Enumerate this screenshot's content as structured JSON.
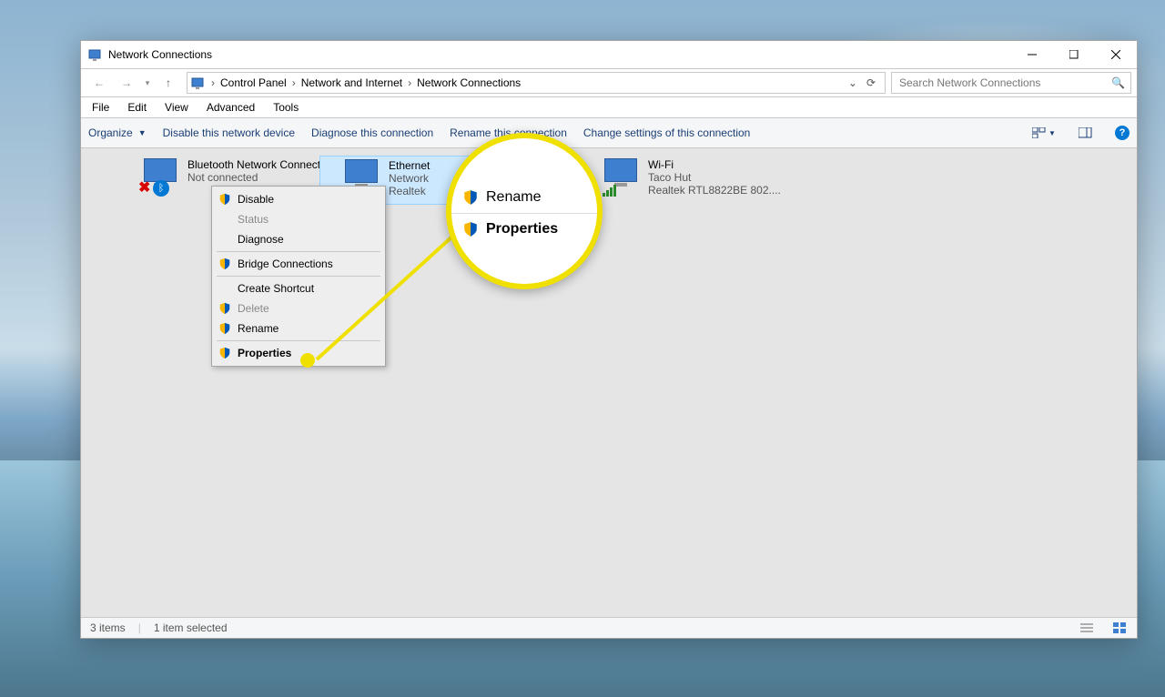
{
  "title": "Network Connections",
  "breadcrumb": [
    "Control Panel",
    "Network and Internet",
    "Network Connections"
  ],
  "search_placeholder": "Search Network Connections",
  "menubar": [
    "File",
    "Edit",
    "View",
    "Advanced",
    "Tools"
  ],
  "cmdbar": {
    "organize": "Organize",
    "links": [
      "Disable this network device",
      "Diagnose this connection",
      "Rename this connection",
      "Change settings of this connection"
    ]
  },
  "adapters": [
    {
      "name": "Bluetooth Network Connection",
      "line2": "Not connected",
      "line3": ""
    },
    {
      "name": "Ethernet",
      "line2": "Network",
      "line3": "Realtek"
    },
    {
      "name": "Wi-Fi",
      "line2": "Taco Hut",
      "line3": "Realtek RTL8822BE 802...."
    }
  ],
  "context_menu": [
    {
      "label": "Disable",
      "shield": true,
      "enabled": true
    },
    {
      "label": "Status",
      "shield": false,
      "enabled": false
    },
    {
      "label": "Diagnose",
      "shield": false,
      "enabled": true
    },
    {
      "sep": true
    },
    {
      "label": "Bridge Connections",
      "shield": true,
      "enabled": true
    },
    {
      "sep": true
    },
    {
      "label": "Create Shortcut",
      "shield": false,
      "enabled": true
    },
    {
      "label": "Delete",
      "shield": true,
      "enabled": false
    },
    {
      "label": "Rename",
      "shield": true,
      "enabled": true
    },
    {
      "sep": true
    },
    {
      "label": "Properties",
      "shield": true,
      "enabled": true,
      "bold": true
    }
  ],
  "magnified": [
    "Rename",
    "Properties"
  ],
  "status": {
    "items": "3 items",
    "selected": "1 item selected"
  }
}
